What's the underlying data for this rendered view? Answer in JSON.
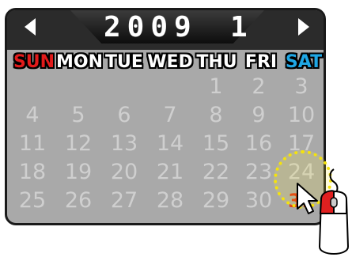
{
  "calendar": {
    "year": "2009",
    "month": "1",
    "weekdays": [
      "SUN",
      "MON",
      "TUE",
      "WED",
      "THU",
      "FRI",
      "SAT"
    ],
    "weeks": [
      [
        "",
        "",
        "",
        "",
        "1",
        "2",
        "3"
      ],
      [
        "4",
        "5",
        "6",
        "7",
        "8",
        "9",
        "10"
      ],
      [
        "11",
        "12",
        "13",
        "14",
        "15",
        "16",
        "17"
      ],
      [
        "18",
        "19",
        "20",
        "21",
        "22",
        "23",
        "24"
      ],
      [
        "25",
        "26",
        "27",
        "28",
        "29",
        "30",
        "31"
      ]
    ],
    "selected_day": "31"
  },
  "colors": {
    "panel": "#a9a9a9",
    "sunday": "#e21b1b",
    "saturday": "#1fa7e5",
    "day_text": "#cfcfcf",
    "selected_text": "#e02d0a",
    "highlight_ring": "#f5e30b"
  },
  "icons": [
    "arrow-left-icon",
    "arrow-right-icon",
    "cursor-icon",
    "mouse-icon"
  ]
}
